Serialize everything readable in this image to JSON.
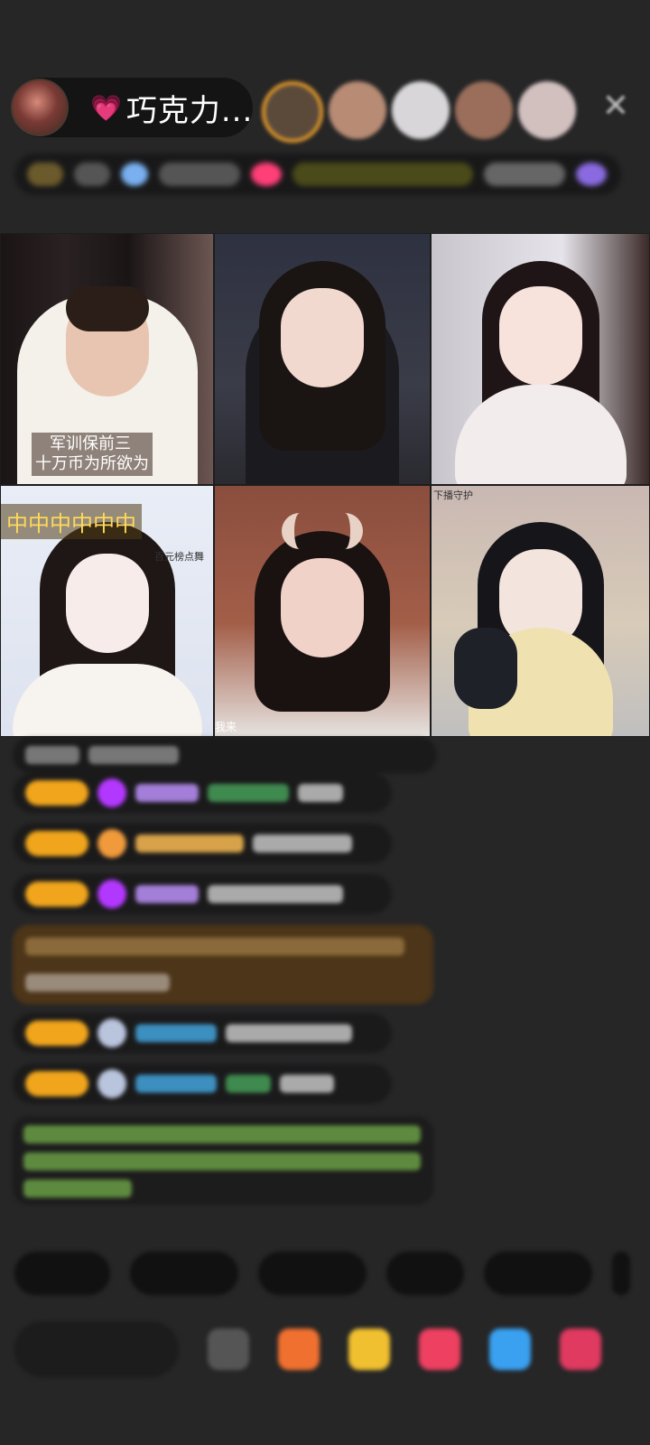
{
  "header": {
    "host_name": "巧克力...",
    "heart_icon": "heart-icon",
    "close_icon": "close-icon"
  },
  "video_grid": {
    "cells": [
      {
        "caption_line1": "军训保前三",
        "caption_line2": "十万币为所欲为"
      },
      {
        "caption": ""
      },
      {
        "caption": ""
      },
      {
        "caption": "中中中中中中",
        "sub_caption": "百元榜点舞"
      },
      {
        "caption": "我来"
      },
      {
        "caption": "下播守护"
      }
    ]
  },
  "colors": {
    "background": "#262627",
    "badge": "#f0a51c",
    "host_heart": "#ff4f9a"
  }
}
